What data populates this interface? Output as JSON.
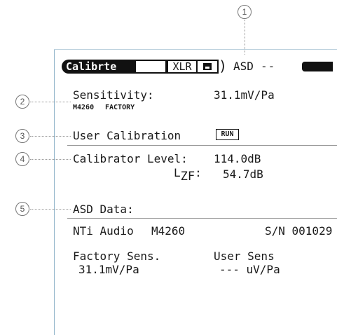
{
  "callouts": [
    "1",
    "2",
    "3",
    "4",
    "5"
  ],
  "top_bar": {
    "mode": "Calibrte",
    "input": "XLR",
    "icon": "device-icon",
    "asd_label": "ASD",
    "asd_status": "--",
    "battery_icon": "battery-icon"
  },
  "sensitivity": {
    "label": "Sensitivity:",
    "value": "31.1mV/Pa",
    "mic_model": "M4260",
    "source": "FACTORY"
  },
  "user_calibration": {
    "label": "User Calibration",
    "button": "RUN"
  },
  "calibrator": {
    "label": "Calibrator Level:",
    "value": "114.0dB",
    "lzf_label_main": "L",
    "lzf_label_sub": "ZF",
    "lzf_label_colon": ":",
    "lzf_value": "54.7dB"
  },
  "asd_data": {
    "label": "ASD Data:",
    "manufacturer": "NTi Audio",
    "model": "M4260",
    "serial": "S/N 001029",
    "factory_sens_label": "Factory Sens.",
    "factory_sens_value": "31.1mV/Pa",
    "user_sens_label": "User Sens",
    "user_sens_value": "--- uV/Pa"
  }
}
